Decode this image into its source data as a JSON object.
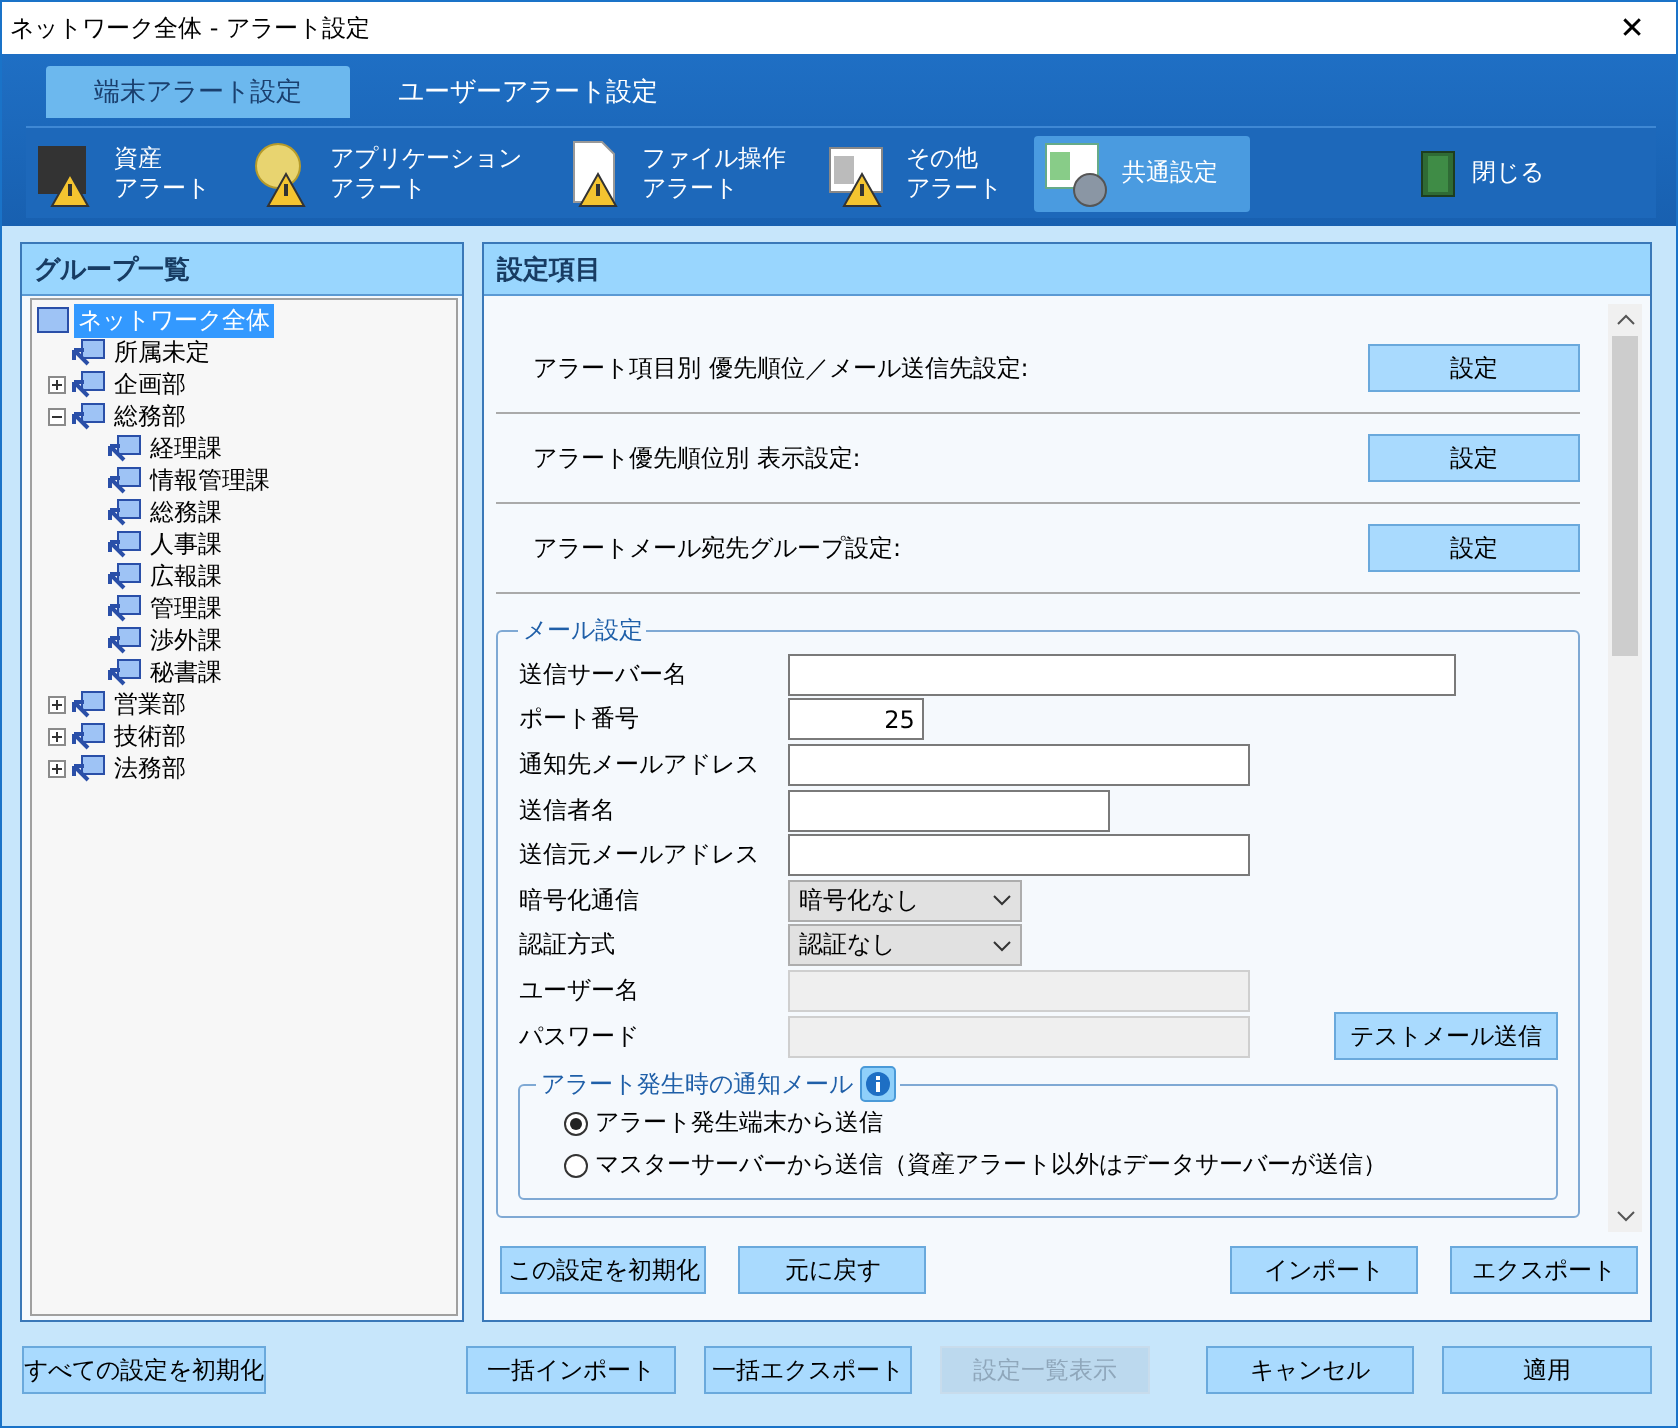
{
  "window": {
    "title": "ネットワーク全体 - アラート設定",
    "close": "✕"
  },
  "tabs": [
    {
      "label": "端末アラート設定",
      "selected": true
    },
    {
      "label": "ユーザーアラート設定",
      "selected": false
    }
  ],
  "toolbar": [
    {
      "kind": "asset",
      "lines": [
        "資産",
        "アラート"
      ],
      "selected": false
    },
    {
      "kind": "app",
      "lines": [
        "アプリケーション",
        "アラート"
      ],
      "selected": false
    },
    {
      "kind": "file",
      "lines": [
        "ファイル操作",
        "アラート"
      ],
      "selected": false
    },
    {
      "kind": "other",
      "lines": [
        "その他",
        "アラート"
      ],
      "selected": false
    },
    {
      "kind": "common",
      "lines": [
        "共通設定"
      ],
      "selected": true
    }
  ],
  "close_button": "閉じる",
  "group_panel": {
    "title": "グループ一覧",
    "tree": [
      {
        "label": "ネットワーク全体",
        "selected": true,
        "kind": "root",
        "children": [
          {
            "label": "所属未定",
            "selected": false
          },
          {
            "label": "企画部",
            "selected": false,
            "expanded": false
          },
          {
            "label": "総務部",
            "selected": false,
            "expanded": true,
            "children": [
              {
                "label": "経理課",
                "selected": false
              },
              {
                "label": "情報管理課",
                "selected": false
              },
              {
                "label": "総務課",
                "selected": false
              },
              {
                "label": "人事課",
                "selected": false
              },
              {
                "label": "広報課",
                "selected": false
              },
              {
                "label": "管理課",
                "selected": false
              },
              {
                "label": "渉外課",
                "selected": false
              },
              {
                "label": "秘書課",
                "selected": false
              }
            ]
          },
          {
            "label": "営業部",
            "selected": false,
            "expanded": false
          },
          {
            "label": "技術部",
            "selected": false,
            "expanded": false
          },
          {
            "label": "法務部",
            "selected": false,
            "expanded": false
          }
        ]
      }
    ]
  },
  "settings_panel": {
    "title": "設定項目",
    "rows": [
      {
        "label": "アラート項目別 優先順位／メール送信先設定:",
        "button": "設定"
      },
      {
        "label": "アラート優先順位別 表示設定:",
        "button": "設定"
      },
      {
        "label": "アラートメール宛先グループ設定:",
        "button": "設定"
      }
    ],
    "mail": {
      "legend": "メール設定",
      "fields": [
        {
          "label": "送信サーバー名",
          "kind": "text",
          "disabled": false
        },
        {
          "label": "ポート番号",
          "kind": "text",
          "value": "25",
          "disabled": false
        },
        {
          "label": "通知先メールアドレス",
          "kind": "text",
          "disabled": false
        },
        {
          "label": "送信者名",
          "kind": "text",
          "disabled": false
        },
        {
          "label": "送信元メールアドレス",
          "kind": "text",
          "disabled": false
        },
        {
          "label": "暗号化通信",
          "kind": "select",
          "value": "暗号化なし"
        },
        {
          "label": "認証方式",
          "kind": "select",
          "value": "認証なし"
        },
        {
          "label": "ユーザー名",
          "kind": "text",
          "disabled": true
        },
        {
          "label": "パスワード",
          "kind": "text",
          "disabled": true
        }
      ],
      "test_button": "テストメール送信",
      "notify": {
        "legend": "アラート発生時の通知メール",
        "options": [
          {
            "label": "アラート発生端末から送信",
            "selected": true
          },
          {
            "label": "マスターサーバーから送信（資産アラート以外はデータサーバーが送信）",
            "selected": false
          }
        ]
      }
    },
    "buttons_left": [
      "この設定を初期化",
      "元に戻す"
    ],
    "buttons_right": [
      "インポート",
      "エクスポート"
    ]
  },
  "footer": [
    {
      "label": "すべての設定を初期化",
      "disabled": false
    },
    {
      "label": "一括インポート",
      "disabled": false
    },
    {
      "label": "一括エクスポート",
      "disabled": false
    },
    {
      "label": "設定一覧表示",
      "disabled": true
    },
    {
      "label": "キャンセル",
      "disabled": false
    },
    {
      "label": "適用",
      "disabled": false
    }
  ]
}
